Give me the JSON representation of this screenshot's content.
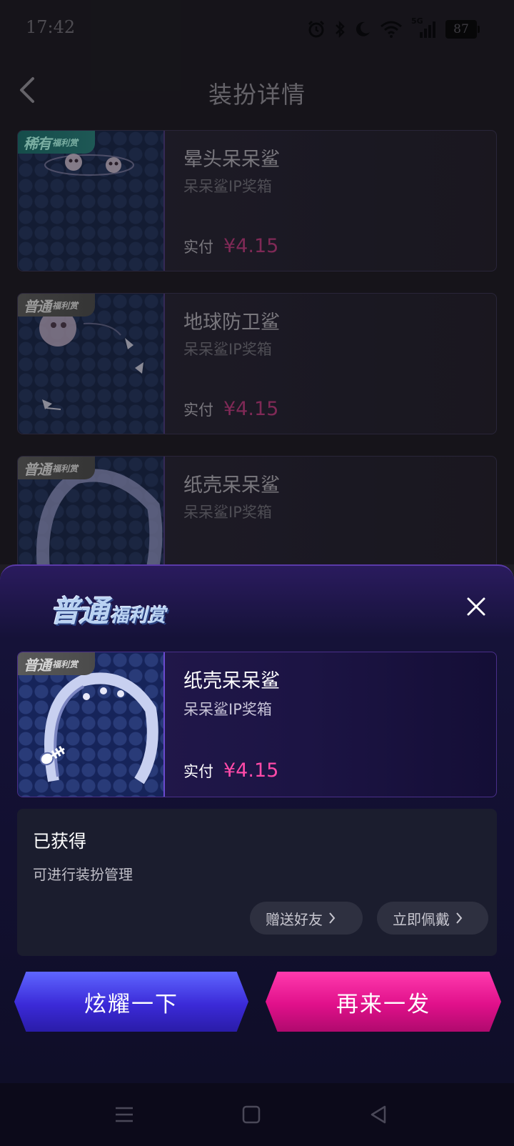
{
  "status_bar": {
    "time": "17:42",
    "network": "5G",
    "battery": "87"
  },
  "header": {
    "title": "装扮详情"
  },
  "items": [
    {
      "rarity_main": "稀有",
      "rarity_sub": "福利赏",
      "name": "晕头呆呆鲨",
      "source": "呆呆鲨IP奖箱",
      "paid_label": "实付",
      "price": "¥4.15"
    },
    {
      "rarity_main": "普通",
      "rarity_sub": "福利赏",
      "name": "地球防卫鲨",
      "source": "呆呆鲨IP奖箱",
      "paid_label": "实付",
      "price": "¥4.15"
    },
    {
      "rarity_main": "普通",
      "rarity_sub": "福利赏",
      "name": "纸壳呆呆鲨",
      "source": "呆呆鲨IP奖箱"
    }
  ],
  "sheet": {
    "title_main": "普通",
    "title_sub": "福利赏",
    "card": {
      "rarity_main": "普通",
      "rarity_sub": "福利赏",
      "name": "纸壳呆呆鲨",
      "source": "呆呆鲨IP奖箱",
      "paid_label": "实付",
      "price": "¥4.15"
    },
    "obtained_title": "已获得",
    "obtained_desc": "可进行装扮管理",
    "gift_label": "赠送好友",
    "wear_label": "立即佩戴",
    "show_off_label": "炫耀一下",
    "again_label": "再来一发"
  },
  "colors": {
    "accent_pink": "#ff4aa8",
    "accent_blue": "#3b2ad8",
    "price_muted": "#b03a78"
  },
  "icons": {
    "back": "chevron-left-icon",
    "close": "close-icon",
    "nav_menu": "menu-icon",
    "nav_home": "square-icon",
    "nav_back": "triangle-back-icon"
  }
}
